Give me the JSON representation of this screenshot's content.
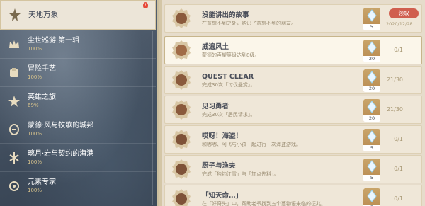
{
  "sidebar": {
    "badge": "!",
    "items": [
      {
        "title": "天地万象",
        "percent": "",
        "icon": "star-emblem-icon"
      },
      {
        "title": "尘世巡游·第一辑",
        "percent": "100%",
        "icon": "crown-emblem-icon"
      },
      {
        "title": "冒险手艺",
        "percent": "100%",
        "icon": "hand-emblem-icon"
      },
      {
        "title": "英雄之旅",
        "percent": "69%",
        "icon": "hero-emblem-icon"
      },
      {
        "title": "蒙德·风与牧歌的城邦",
        "percent": "100%",
        "icon": "mondstadt-emblem-icon"
      },
      {
        "title": "璃月·岩与契约的海港",
        "percent": "100%",
        "icon": "liyue-emblem-icon"
      },
      {
        "title": "元素专家",
        "percent": "100%",
        "icon": "element-emblem-icon"
      }
    ]
  },
  "achievements": [
    {
      "title": "没能讲出的故事",
      "desc": "在意想不到之处，结识了意想不到的朋友。",
      "reward": "5",
      "claim": "领取",
      "date": "2020/12/28",
      "progress": ""
    },
    {
      "title": "威遍风土",
      "desc": "蒙德的声望等级达到8级。",
      "reward": "20",
      "claim": "",
      "date": "",
      "progress": "0/1"
    },
    {
      "title": "QUEST CLEAR",
      "desc": "完成30次「讨伐悬赏」。",
      "reward": "20",
      "claim": "",
      "date": "",
      "progress": "21/30"
    },
    {
      "title": "见习勇者",
      "desc": "完成30次「居民请求」。",
      "reward": "20",
      "claim": "",
      "date": "",
      "progress": "21/30"
    },
    {
      "title": "哎呀！海盗！",
      "desc": "和嘟嘟、阿飞与小孩一起进行一次海盗游戏。",
      "reward": "5",
      "claim": "",
      "date": "",
      "progress": "0/1"
    },
    {
      "title": "厨子与渔夫",
      "desc": "完成「独钓江雪」与「加点佐料」。",
      "reward": "5",
      "claim": "",
      "date": "",
      "progress": "0/1"
    },
    {
      "title": "「知天命…」",
      "desc": "在「好奇头」中，帮助老爷找到五个蔓物语来临的征兆。",
      "reward": "5",
      "claim": "",
      "date": "",
      "progress": "0/1"
    }
  ],
  "colors": {
    "accent_gold": "#d9c48c",
    "claim_red": "#d05f4f",
    "panel_bg": "#e6dccb"
  }
}
